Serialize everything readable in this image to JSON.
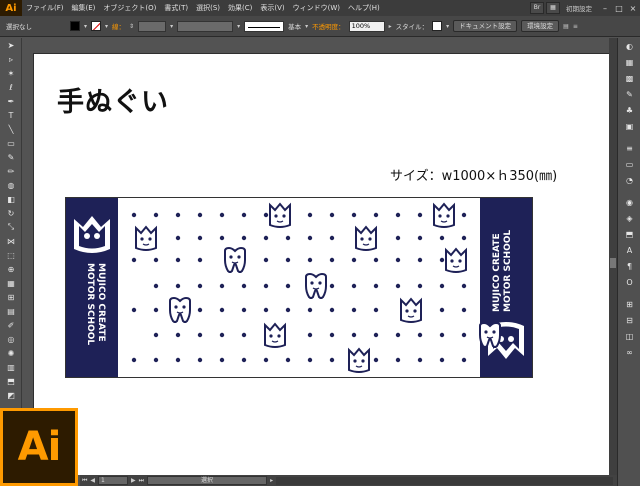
{
  "app": {
    "logo_text": "Ai",
    "menus": [
      "ファイル(F)",
      "編集(E)",
      "オブジェクト(O)",
      "書式(T)",
      "選択(S)",
      "効果(C)",
      "表示(V)",
      "ウィンドウ(W)",
      "ヘルプ(H)"
    ],
    "workspace": "初期設定"
  },
  "controlbar": {
    "selection": "選択なし",
    "stroke_label": "線：",
    "stroke_style": "基本",
    "opacity_label": "不透明度：",
    "opacity_value": "100%",
    "style_label": "スタイル：",
    "doc_settings": "ドキュメント設定",
    "env_settings": "環境設定"
  },
  "artwork": {
    "title": "手ぬぐい",
    "size": "サイズ：w1000×ｈ350(㎜)",
    "band_text": [
      "MUJICO CREATE",
      "MOTOR SCHOOL"
    ],
    "navy": "#1e2157"
  },
  "statusbar": {
    "zoom": "1",
    "tool_label": "選択"
  },
  "big_logo": "Ai"
}
